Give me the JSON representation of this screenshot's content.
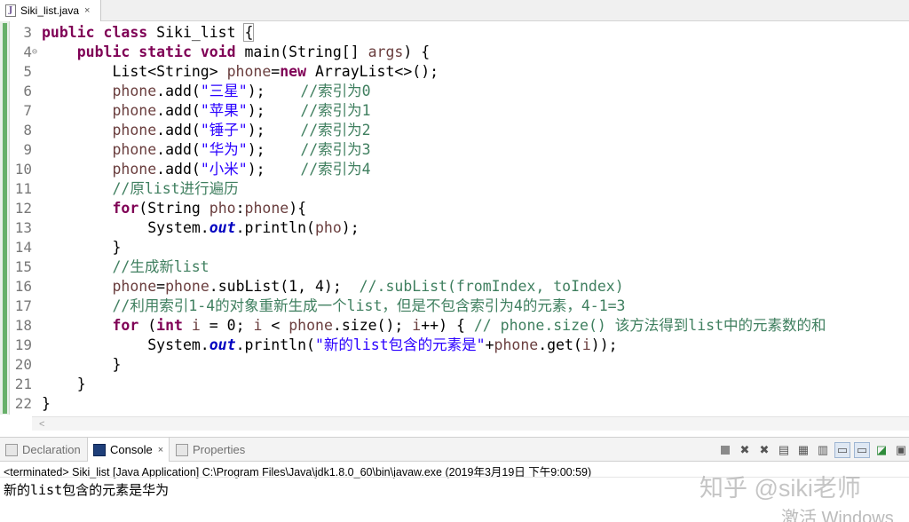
{
  "editor_tab": {
    "filename": "Siki_list.java",
    "close_glyph": "×"
  },
  "code": [
    {
      "n": "3",
      "segs": [
        [
          "kw",
          "public class "
        ],
        [
          "",
          "Siki_list "
        ],
        [
          "bracket",
          "{"
        ]
      ]
    },
    {
      "n": "4",
      "fold": "⊖",
      "segs": [
        [
          "",
          "    "
        ],
        [
          "kw",
          "public static void "
        ],
        [
          "",
          "main(String[] "
        ],
        [
          "var",
          "args"
        ],
        [
          "",
          ") {"
        ]
      ]
    },
    {
      "n": "5",
      "segs": [
        [
          "",
          "        List<String> "
        ],
        [
          "var",
          "phone"
        ],
        [
          "",
          "="
        ],
        [
          "kw",
          "new "
        ],
        [
          "",
          "ArrayList<>();"
        ]
      ]
    },
    {
      "n": "6",
      "segs": [
        [
          "",
          "        "
        ],
        [
          "var",
          "phone"
        ],
        [
          "",
          ".add("
        ],
        [
          "st",
          "\"三星\""
        ],
        [
          "",
          ");    "
        ],
        [
          "cm",
          "//索引为0"
        ]
      ]
    },
    {
      "n": "7",
      "segs": [
        [
          "",
          "        "
        ],
        [
          "var",
          "phone"
        ],
        [
          "",
          ".add("
        ],
        [
          "st",
          "\"苹果\""
        ],
        [
          "",
          ");    "
        ],
        [
          "cm",
          "//索引为1"
        ]
      ]
    },
    {
      "n": "8",
      "segs": [
        [
          "",
          "        "
        ],
        [
          "var",
          "phone"
        ],
        [
          "",
          ".add("
        ],
        [
          "st",
          "\"锤子\""
        ],
        [
          "",
          ");    "
        ],
        [
          "cm",
          "//索引为2"
        ]
      ]
    },
    {
      "n": "9",
      "segs": [
        [
          "",
          "        "
        ],
        [
          "var",
          "phone"
        ],
        [
          "",
          ".add("
        ],
        [
          "st",
          "\"华为\""
        ],
        [
          "",
          ");    "
        ],
        [
          "cm",
          "//索引为3"
        ]
      ]
    },
    {
      "n": "10",
      "segs": [
        [
          "",
          "        "
        ],
        [
          "var",
          "phone"
        ],
        [
          "",
          ".add("
        ],
        [
          "st",
          "\"小米\""
        ],
        [
          "",
          ");    "
        ],
        [
          "cm",
          "//索引为4"
        ]
      ]
    },
    {
      "n": "11",
      "segs": [
        [
          "",
          "        "
        ],
        [
          "cm",
          "//原list进行遍历"
        ]
      ]
    },
    {
      "n": "12",
      "segs": [
        [
          "",
          "        "
        ],
        [
          "kw",
          "for"
        ],
        [
          "",
          "(String "
        ],
        [
          "var",
          "pho"
        ],
        [
          "",
          ":"
        ],
        [
          "var",
          "phone"
        ],
        [
          "",
          "){"
        ]
      ]
    },
    {
      "n": "13",
      "segs": [
        [
          "",
          "            System."
        ],
        [
          "fld",
          "out"
        ],
        [
          "",
          ".println("
        ],
        [
          "var",
          "pho"
        ],
        [
          "",
          ");"
        ]
      ]
    },
    {
      "n": "14",
      "segs": [
        [
          "",
          "        }"
        ]
      ]
    },
    {
      "n": "15",
      "segs": [
        [
          "",
          "        "
        ],
        [
          "cm",
          "//生成新list"
        ]
      ]
    },
    {
      "n": "16",
      "segs": [
        [
          "",
          "        "
        ],
        [
          "var",
          "phone"
        ],
        [
          "",
          "="
        ],
        [
          "var",
          "phone"
        ],
        [
          "",
          ".subList(1, 4);  "
        ],
        [
          "cm",
          "//.subList(fromIndex, toIndex)"
        ]
      ]
    },
    {
      "n": "17",
      "segs": [
        [
          "",
          "        "
        ],
        [
          "cm",
          "//利用索引1-4的对象重新生成一个list，但是不包含索引为4的元素，4-1=3"
        ]
      ]
    },
    {
      "n": "18",
      "segs": [
        [
          "",
          "        "
        ],
        [
          "kw",
          "for "
        ],
        [
          "",
          "("
        ],
        [
          "kw",
          "int "
        ],
        [
          "var",
          "i"
        ],
        [
          "",
          " = 0; "
        ],
        [
          "var",
          "i"
        ],
        [
          "",
          " < "
        ],
        [
          "var",
          "phone"
        ],
        [
          "",
          ".size(); "
        ],
        [
          "var",
          "i"
        ],
        [
          "",
          "++) { "
        ],
        [
          "cm",
          "// phone.size() 该方法得到list中的元素数的和"
        ]
      ]
    },
    {
      "n": "19",
      "segs": [
        [
          "",
          "            System."
        ],
        [
          "fld",
          "out"
        ],
        [
          "",
          ".println("
        ],
        [
          "st",
          "\"新的list包含的元素是\""
        ],
        [
          "",
          "+"
        ],
        [
          "var",
          "phone"
        ],
        [
          "",
          ".get("
        ],
        [
          "var",
          "i"
        ],
        [
          "",
          "));"
        ]
      ]
    },
    {
      "n": "20",
      "segs": [
        [
          "",
          "        }"
        ]
      ]
    },
    {
      "n": "21",
      "segs": [
        [
          "",
          "    }"
        ]
      ]
    },
    {
      "n": "22",
      "segs": [
        [
          "",
          "}"
        ]
      ]
    }
  ],
  "scroll_arrow": "<",
  "panel_tabs": [
    {
      "label": "Declaration",
      "active": false
    },
    {
      "label": "Console",
      "active": true,
      "close": "×"
    },
    {
      "label": "Properties",
      "active": false
    }
  ],
  "console_toolbar": [
    "stop-icon",
    "remove-launch-icon",
    "remove-all-icon",
    "scroll-lock-icon",
    "word-wrap-icon",
    "pin-icon",
    "show-stdout-icon",
    "show-stderr-icon",
    "open-console-icon",
    "display-console-icon"
  ],
  "terminated_line": "<terminated> Siki_list [Java Application] C:\\Program Files\\Java\\jdk1.8.0_60\\bin\\javaw.exe (2019年3月19日 下午9:00:59)",
  "console_output": "新的list包含的元素是华为",
  "watermark": "知乎 @siki老师",
  "activate_text": "激活 Windows",
  "colors": {
    "keyword": "#7f0055",
    "comment": "#3f7f5f",
    "string": "#2a00ff",
    "field": "#0000c0",
    "local_var": "#6a3e3e"
  }
}
